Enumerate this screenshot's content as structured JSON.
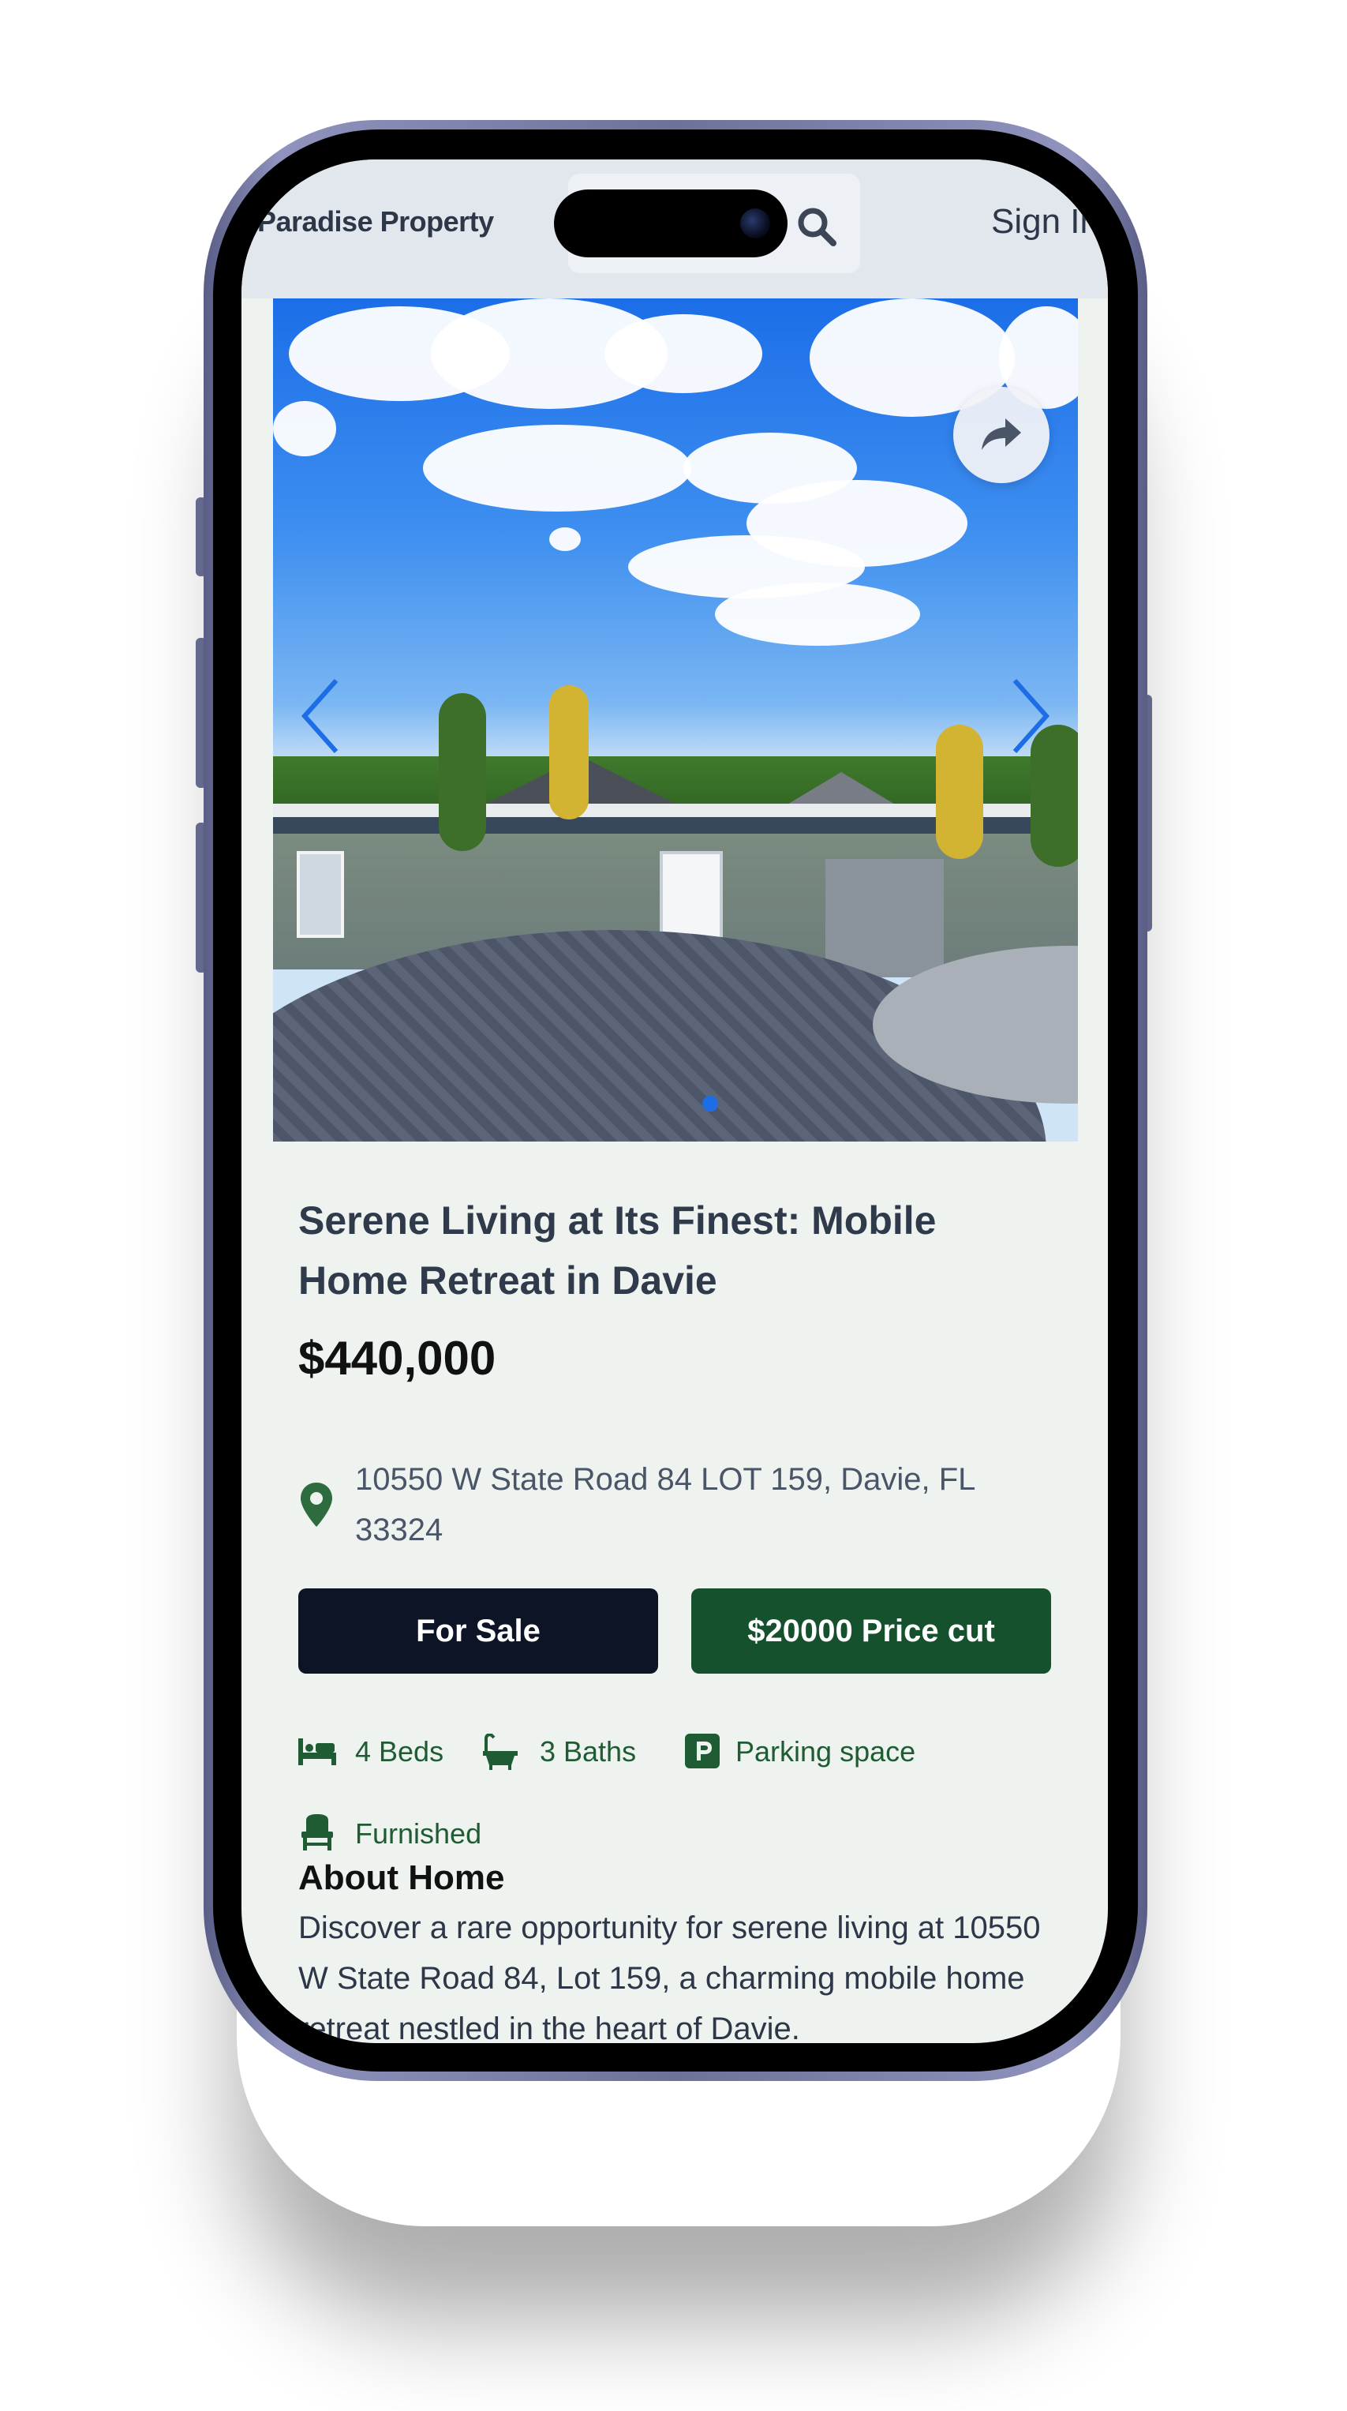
{
  "header": {
    "brand": "Paradise Property",
    "signin_label": "Sign In"
  },
  "listing": {
    "title": "Serene Living at Its Finest: Mobile Home Retreat in Davie",
    "price": "$440,000",
    "address": "10550 W State Road 84 LOT 159, Davie, FL 33324",
    "status_button": "For Sale",
    "price_cut_button": "$20000 Price cut",
    "carousel": {
      "current_slide": 1,
      "total_dots": 1
    },
    "features": {
      "beds": "4 Beds",
      "baths": "3 Baths",
      "parking": "Parking space",
      "furnished": "Furnished"
    },
    "about_heading": "About Home",
    "about_text": "Discover a rare opportunity for serene living at 10550 W State Road 84, Lot 159, a charming mobile home retreat nestled in the heart of Davie."
  },
  "colors": {
    "accent_green": "#16512d",
    "dark_navy": "#0c1426",
    "carousel_dot": "#1d6ee6"
  }
}
